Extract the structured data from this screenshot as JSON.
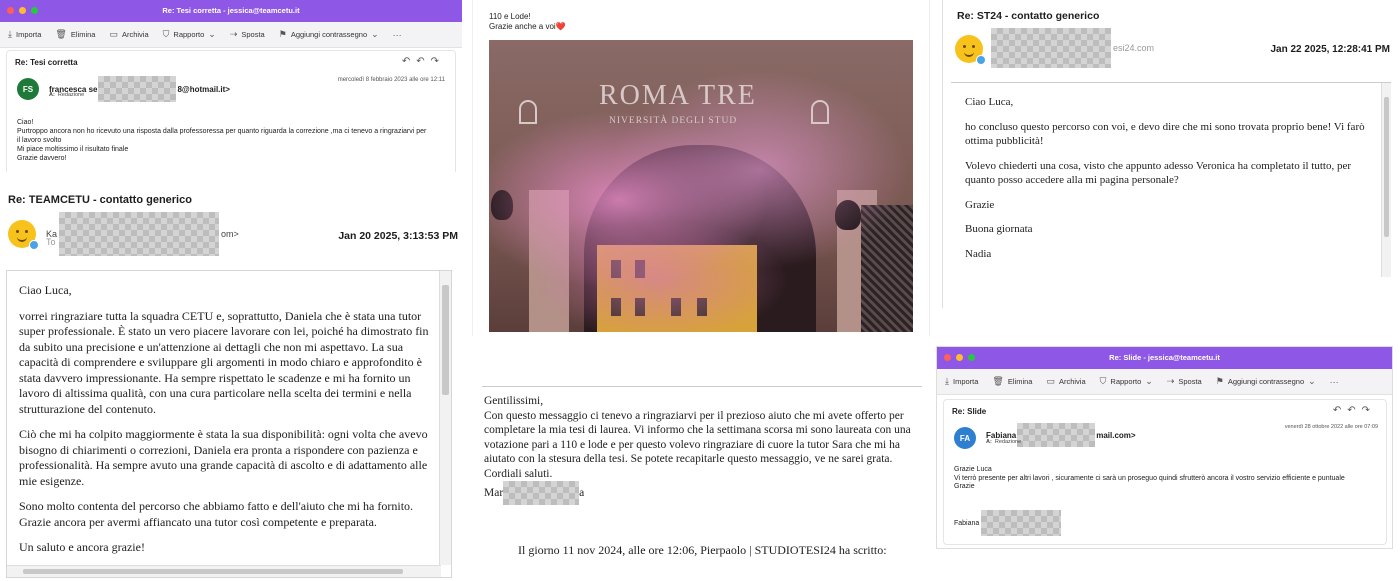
{
  "p1": {
    "window_title": "Re: Tesi corretta - jessica@teamcetu.it",
    "toolbar": [
      "Importa",
      "Elimina",
      "Archivia",
      "Rapporto",
      "Sposta",
      "Aggiungi contrassegno"
    ],
    "subject": "Re: Tesi corretta",
    "avatar": "FS",
    "sender_prefix": "francesca se",
    "sender_suffix": "8@hotmail.it>",
    "to_label": "A:",
    "to_value": "Redazione",
    "date": "mercoledì 8 febbraio 2023 alle ore 12:11",
    "body": [
      "Ciao!",
      "Purtroppo ancora non ho ricevuto una risposta dalla professoressa per quanto riguarda la correzione ,ma ci tenevo a ringraziarvi per il lavoro svolto",
      "Mi piace moltissimo il risultato finale",
      "Grazie davvero!"
    ]
  },
  "p2": {
    "subject": "Re: TEAMCETU - contatto generico",
    "sender_prefix": "Ka",
    "sender_suffix": "om>",
    "to_prefix": "To",
    "date": "Jan 20 2025, 3:13:53 PM",
    "greeting": "Ciao Luca,",
    "paragraphs": [
      "vorrei ringraziare tutta la squadra CETU e, soprattutto, Daniela che è stata una tutor super professionale. È stato un vero piacere lavorare con lei, poiché ha dimostrato fin da subito una precisione e un'attenzione ai dettagli che non mi aspettavo. La sua capacità di comprendere e sviluppare gli argomenti in modo chiaro e approfondito è stata davvero impressionante. Ha sempre rispettato le scadenze e mi ha fornito un lavoro di altissima qualità, con una cura particolare nella scelta dei termini e nella strutturazione del contenuto.",
      "Ciò che mi ha colpito maggiormente è stata la sua disponibilità: ogni volta che avevo bisogno di chiarimenti o correzioni, Daniela era pronta a rispondere con pazienza e professionalità. Ha sempre avuto una grande capacità di ascolto e di adattamento alle mie esigenze.",
      "Sono molto contenta del percorso che abbiamo fatto e dell'aiuto che mi ha fornito. Grazie ancora per avermi affiancato una tutor così competente e preparata.",
      "Un saluto e ancora grazie!"
    ]
  },
  "p3": {
    "line1": "110 e Lode!",
    "line2": "Grazie anche a voi",
    "heart": "❤️",
    "building_title": "ROMA TRE",
    "building_subtitle": "NIVERSITÀ DEGLI STUD"
  },
  "p4": {
    "subject": "Re: ST24 - contatto generico",
    "sender_prefix": "",
    "sender_suffix": "esi24.com",
    "date": "Jan 22 2025, 12:28:41 PM",
    "greeting": "Ciao Luca,",
    "paragraphs": [
      "ho concluso questo percorso con voi, e devo dire che mi sono trovata proprio bene! Vi farò ottima pubblicità!",
      "Volevo chiederti una cosa, visto che appunto adesso Veronica ha completato il tutto, per quanto posso accedere alla mi pagina personale?",
      "Grazie",
      "Buona giornata",
      "Nadia"
    ]
  },
  "p5": {
    "greeting": "Gentilissimi,",
    "body": "Con questo messaggio ci tenevo a ringraziarvi per il prezioso aiuto che mi avete offerto per completare la mia tesi di laurea. Vi informo che la settimana scorsa mi sono laureata con una votazione pari a 110 e lode e per questo volevo ringraziare di cuore la tutor Sara che mi ha aiutato con la stesura della tesi. Se potete recapitarle questo messaggio, ve ne sarei grata.",
    "closing": "Cordiali saluti.",
    "sig_prefix": "Mar",
    "sig_suffix": "a",
    "quote": "Il giorno 11 nov 2024, alle ore 12:06, Pierpaolo | STUDIOTESI24 ha scritto:"
  },
  "p6": {
    "window_title": "Re: Slide - jessica@teamcetu.it",
    "toolbar": [
      "Importa",
      "Elimina",
      "Archivia",
      "Rapporto",
      "Sposta",
      "Aggiungi contrassegno"
    ],
    "subject": "Re: Slide",
    "avatar": "FA",
    "sender_prefix": "Fabiana",
    "sender_suffix": "mail.com>",
    "to_label": "A:",
    "to_value": "Redazione",
    "date": "venerdì 28 ottobre 2022 alle ore 07:09",
    "body": [
      "Grazie Luca",
      "Vi terrò presente per altri lavori , sicuramente ci sarà un proseguo quindi sfrutterò ancora il vostro servizio efficiente e puntuale",
      "Grazie"
    ],
    "signature": "Fabiana"
  },
  "colors": {
    "titlebar": "#8e57e6",
    "avatar_fs": "#1f7a3a",
    "avatar_fa": "#2f7fd1"
  }
}
